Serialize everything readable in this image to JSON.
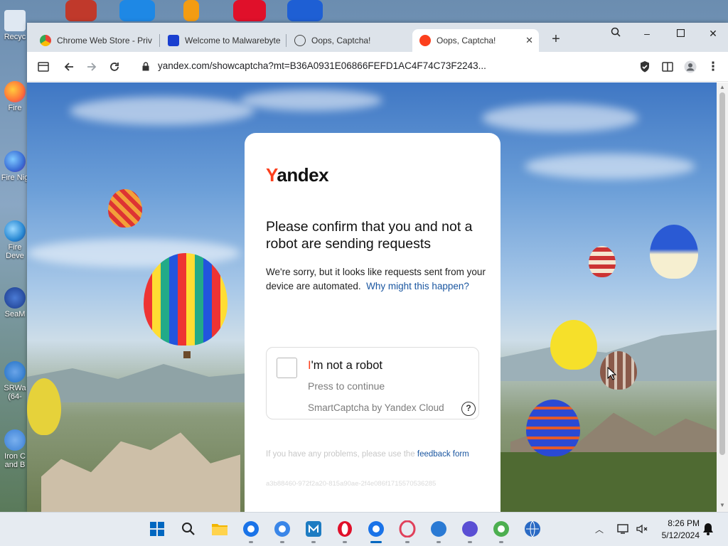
{
  "desktop": {
    "icons": [
      {
        "label": "Recyc",
        "color": "#3a7bd5"
      },
      {
        "label": "Fire",
        "color": "#ff7139"
      },
      {
        "label": "Fire Nig",
        "color": "#3b6fd6"
      },
      {
        "label": "Fire Deve",
        "color": "#2a8ad4"
      },
      {
        "label": "SeaM",
        "color": "#cc3333"
      },
      {
        "label": "SRWa (64-",
        "color": "#1f6fc4"
      },
      {
        "label": "Iron C and B",
        "color": "#3a7fd5"
      }
    ]
  },
  "browser": {
    "tabs": [
      {
        "title": "Chrome Web Store - Priv",
        "icon": "chrome-webstore-icon",
        "color": "#e8a33d"
      },
      {
        "title": "Welcome to Malwarebyte",
        "icon": "malwarebytes-icon",
        "color": "#1a3fd0"
      },
      {
        "title": "Oops, Captcha!",
        "icon": "globe-icon",
        "color": "#444444"
      },
      {
        "title": "Oops, Captcha!",
        "icon": "yandex-icon",
        "color": "#fc3f1d"
      }
    ],
    "url": "yandex.com/showcaptcha?mt=B36A0931E06866FEFD1AC4F74C73F2243..."
  },
  "captcha": {
    "logo_y": "Y",
    "logo_rest": "andex",
    "heading": "Please confirm that you and not a robot are sending requests",
    "description": "We're sorry, but it looks like requests sent from your device are automated.",
    "why_link": "Why might this happen?",
    "robot_label_first": "I",
    "robot_label_rest": "'m not a robot",
    "press_to_continue": "Press to continue",
    "smartcaptcha": "SmartCaptcha by Yandex Cloud",
    "help_glyph": "?",
    "problems_text": "If you have any problems, please use the",
    "feedback_link": "feedback form",
    "hash": "a3b88460-972f2a20-815a90ae-2f4e086f1715570536285"
  },
  "taskbar": {
    "apps": [
      {
        "name": "start",
        "color": "#0067c0"
      },
      {
        "name": "search",
        "color": "#222222"
      },
      {
        "name": "file-explorer",
        "color": "#f2b600"
      },
      {
        "name": "chrome-canary",
        "color": "#1a73e8"
      },
      {
        "name": "chrome-beta",
        "color": "#3a86e8"
      },
      {
        "name": "maxthon",
        "color": "#1e7cc2"
      },
      {
        "name": "opera",
        "color": "#e0102a"
      },
      {
        "name": "chrome",
        "color": "#1a73e8"
      },
      {
        "name": "opera-gx",
        "color": "#e0405a"
      },
      {
        "name": "firefox",
        "color": "#2a7ad4"
      },
      {
        "name": "firefox-nightly",
        "color": "#5a4fd4"
      },
      {
        "name": "srware-iron",
        "color": "#4caf50"
      },
      {
        "name": "globe-browser",
        "color": "#2a6ac4"
      }
    ],
    "time": "8:26 PM",
    "date": "5/12/2024"
  }
}
